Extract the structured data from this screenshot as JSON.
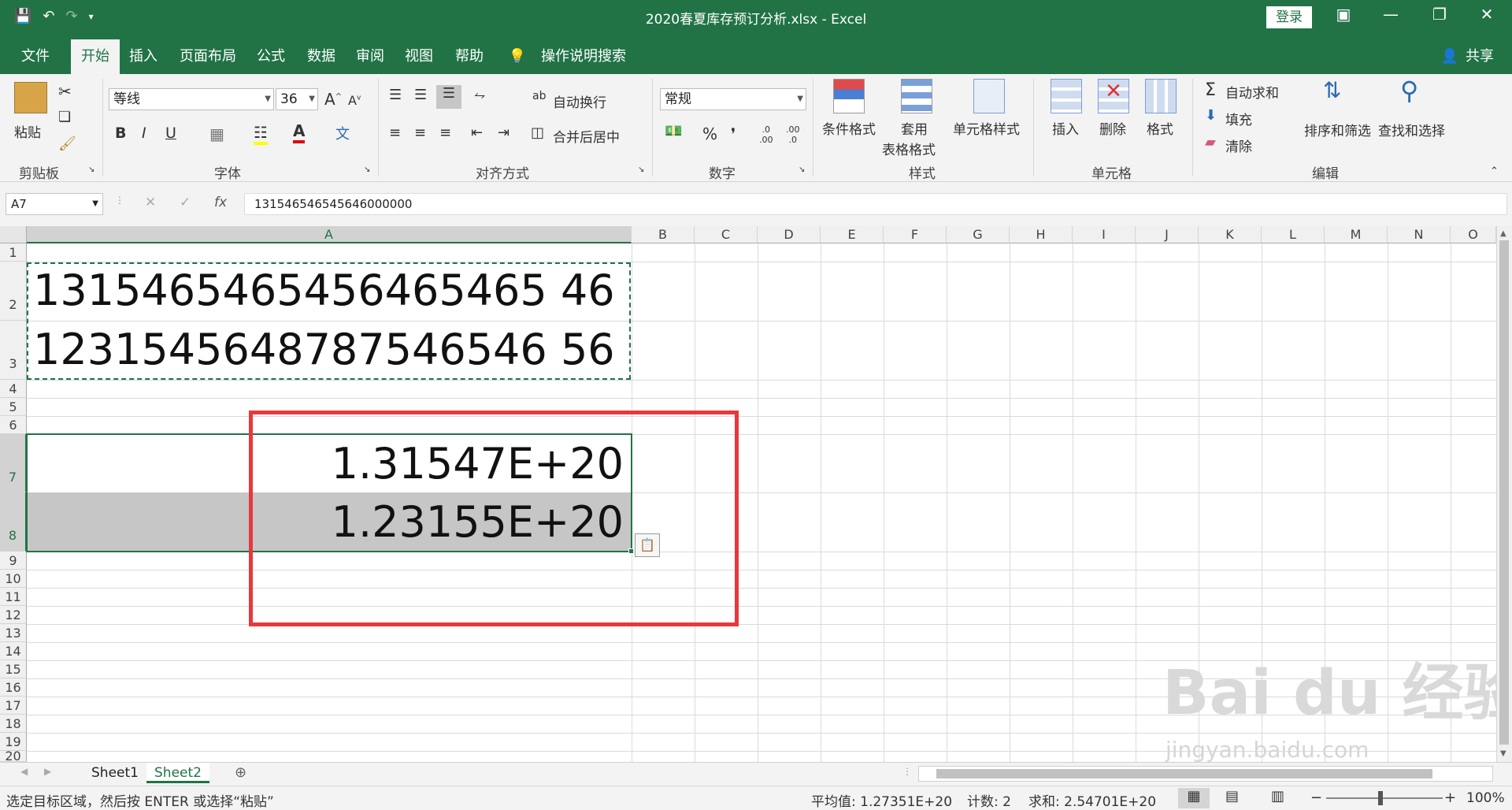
{
  "window": {
    "title": "2020春夏库存预订分析.xlsx  -  Excel",
    "login_label": "登录",
    "share_label": "共享"
  },
  "tabs": [
    "文件",
    "开始",
    "插入",
    "页面布局",
    "公式",
    "数据",
    "审阅",
    "视图",
    "帮助"
  ],
  "tell_me": "操作说明搜索",
  "ribbon": {
    "clipboard": {
      "paste": "粘贴",
      "label": "剪贴板"
    },
    "font": {
      "name": "等线",
      "size": "36",
      "bold": "B",
      "italic": "I",
      "underline": "U",
      "label": "字体"
    },
    "alignment": {
      "wrap": "自动换行",
      "merge": "合并后居中",
      "label": "对齐方式"
    },
    "number": {
      "format": "常规",
      "percent": "%",
      "comma": "❜",
      "label": "数字"
    },
    "styles": {
      "conditional": "条件格式",
      "table_line1": "套用",
      "table_line2": "表格格式",
      "cell_styles": "单元格样式",
      "label": "样式"
    },
    "cells": {
      "insert": "插入",
      "delete": "删除",
      "format": "格式",
      "label": "单元格"
    },
    "editing": {
      "autosum": "自动求和",
      "fill": "填充",
      "clear": "清除",
      "sort": "排序和筛选",
      "find": "查找和选择",
      "label": "编辑"
    }
  },
  "formula_bar": {
    "namebox": "A7",
    "content": "131546546545646000000",
    "fx": "fx"
  },
  "columns": [
    "A",
    "B",
    "C",
    "D",
    "E",
    "F",
    "G",
    "H",
    "I",
    "J",
    "K",
    "L",
    "M",
    "N",
    "O"
  ],
  "rows": [
    "1",
    "2",
    "3",
    "4",
    "5",
    "6",
    "7",
    "8",
    "9",
    "10",
    "11",
    "12",
    "13",
    "14",
    "15",
    "16",
    "17",
    "18",
    "19",
    "20"
  ],
  "cells": {
    "A2": "1315465465456465465 46",
    "A3": "1231545648787546546 56",
    "A7": "1.31547E+20",
    "A8": "1.23155E+20"
  },
  "sheets": [
    "Sheet1",
    "Sheet2"
  ],
  "status": {
    "message": "选定目标区域，然后按 ENTER 或选择“粘贴”",
    "average": "平均值: 1.27351E+20",
    "count": "计数: 2",
    "sum": "求和: 2.54701E+20",
    "zoom": "100%"
  },
  "watermark": {
    "brand_text": "Bai du 经验",
    "url": "jingyan.baidu.com"
  },
  "colors": {
    "excel_green": "#217346",
    "highlight_red": "#e8383d",
    "selection_gray": "#c6c6c6"
  }
}
